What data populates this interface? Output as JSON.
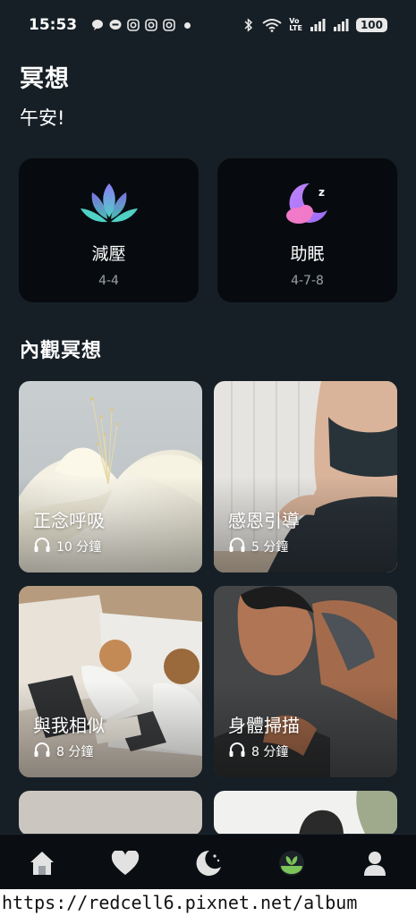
{
  "status_bar": {
    "time": "15:53",
    "battery": "100",
    "volte_top": "Vo",
    "volte_bottom": "LTE",
    "icons": [
      "chat-bubble-icon",
      "line-icon",
      "instagram-icon",
      "instagram-icon",
      "instagram-icon",
      "dot-icon",
      "bluetooth-icon",
      "wifi-icon",
      "volte-icon",
      "signal-icon",
      "signal-icon",
      "battery-icon"
    ]
  },
  "header": {
    "title": "冥想",
    "greeting": "午安!"
  },
  "quick_cards": [
    {
      "label": "減壓",
      "sub": "4-4",
      "icon": "lotus-icon"
    },
    {
      "label": "助眠",
      "sub": "4-7-8",
      "icon": "moon-sleep-icon"
    }
  ],
  "section_title": "內觀冥想",
  "meditations": [
    {
      "title": "正念呼吸",
      "duration": "10 分鐘",
      "icon": "headphones-icon"
    },
    {
      "title": "感恩引導",
      "duration": "5 分鐘",
      "icon": "headphones-icon"
    },
    {
      "title": "與我相似",
      "duration": "8 分鐘",
      "icon": "headphones-icon"
    },
    {
      "title": "身體掃描",
      "duration": "8 分鐘",
      "icon": "headphones-icon"
    }
  ],
  "bottom_nav": [
    {
      "name": "home",
      "icon": "home-icon",
      "active": false
    },
    {
      "name": "favorites",
      "icon": "heart-icon",
      "active": false
    },
    {
      "name": "sleep",
      "icon": "moon-icon",
      "active": false
    },
    {
      "name": "meditation",
      "icon": "sprout-icon",
      "active": true
    },
    {
      "name": "profile",
      "icon": "user-icon",
      "active": false
    }
  ],
  "colors": {
    "background": "#161f25",
    "card": "#070b0f",
    "accent_green": "#7cc35a",
    "lotus_teal": "#4fd1c5",
    "moon_purple": "#b57bf0"
  },
  "watermark": "https://redcell6.pixnet.net/album"
}
